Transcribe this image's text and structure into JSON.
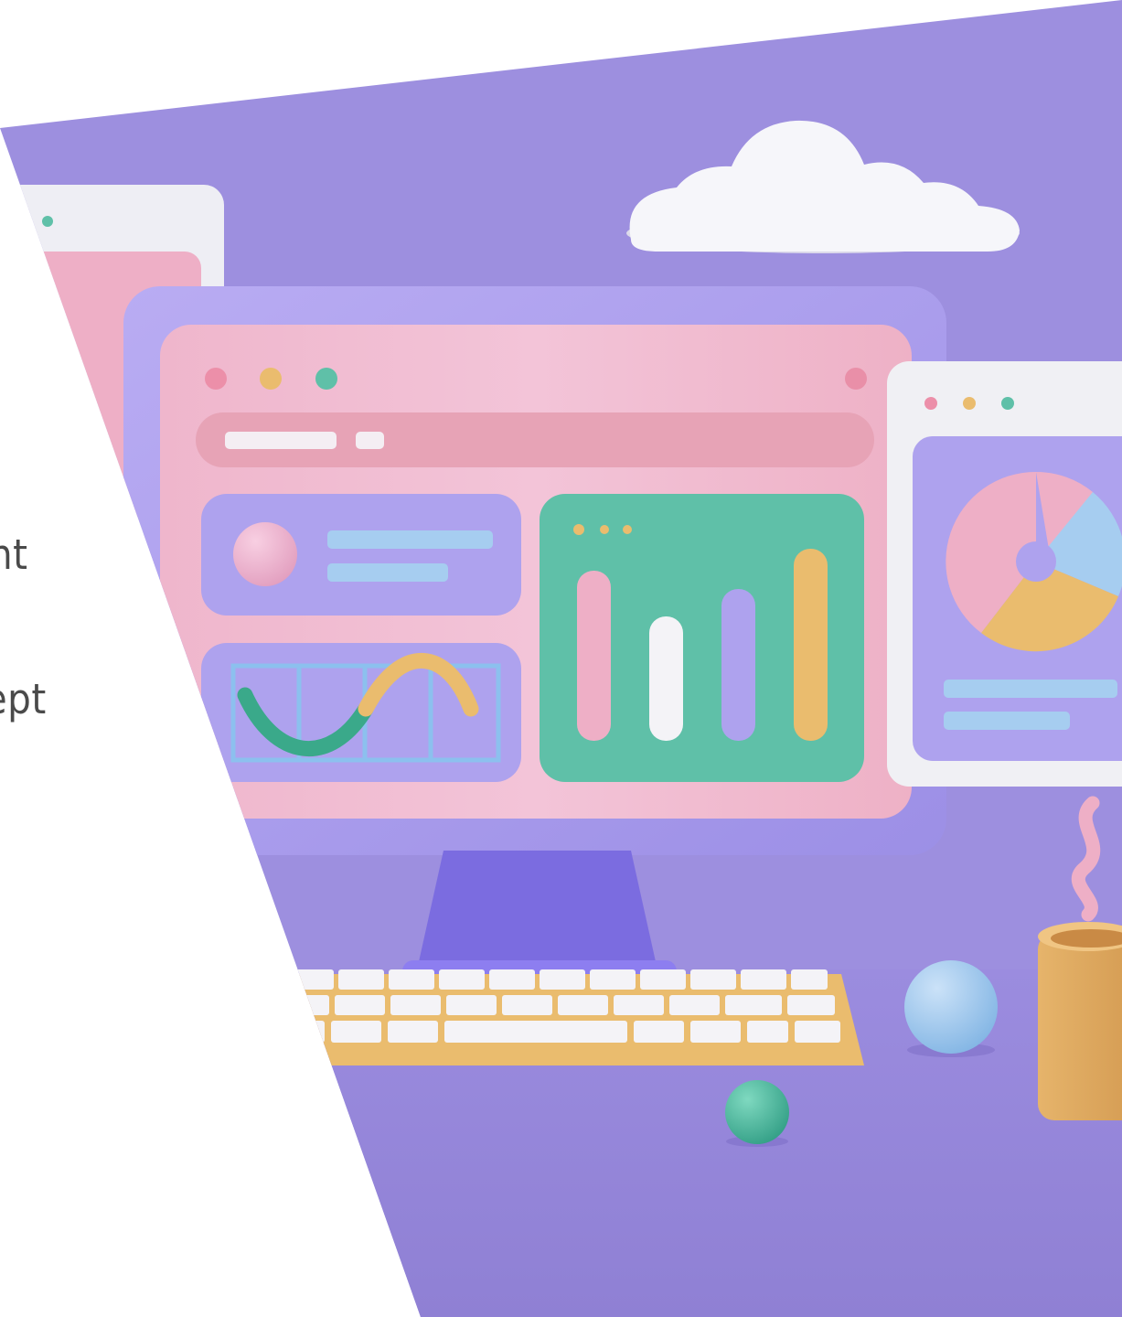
{
  "slide": {
    "text_fragments": [
      "nt",
      "cept"
    ],
    "colors": {
      "background_purple": "#9d8fdf",
      "floor_purple": "#9384d6",
      "pink": "#eeadc3",
      "lavender": "#aea2ee",
      "mint": "#5fc0a8",
      "mustard": "#eabc6e",
      "sky_blue": "#a6cdf0",
      "white": "#f4f3f7",
      "text_gray": "#4a4a4a"
    }
  }
}
